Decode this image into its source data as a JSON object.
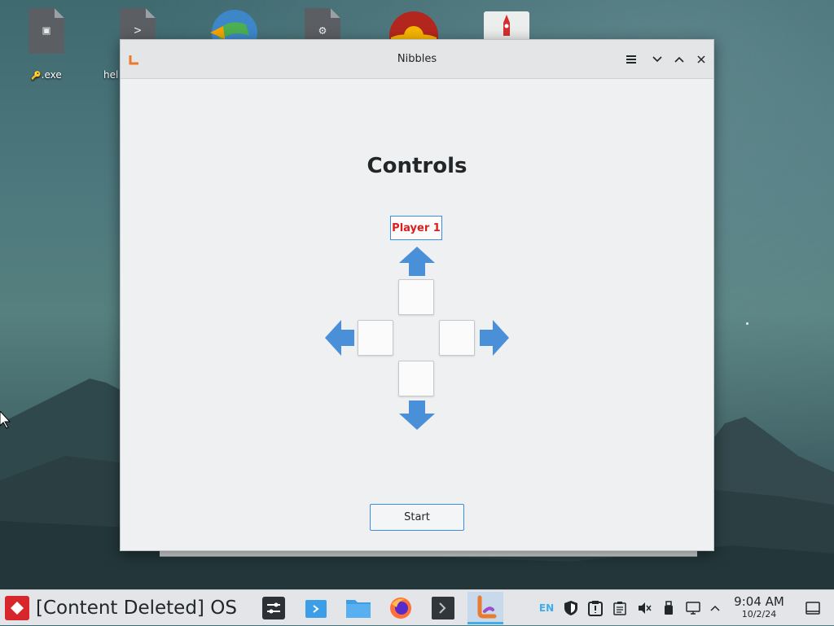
{
  "desktop": {
    "icons": [
      {
        "label": ".exe",
        "prefix_glyph": "🔑",
        "kind": "exe-file-icon"
      },
      {
        "label": "hel",
        "kind": "script-file-icon"
      },
      {
        "label": "",
        "kind": "globe-download-icon"
      },
      {
        "label": "",
        "kind": "settings-file-icon"
      },
      {
        "label": "",
        "kind": "chrome-app-icon"
      },
      {
        "label": "",
        "kind": "rocket-app-icon"
      }
    ]
  },
  "window": {
    "title": "Nibbles",
    "heading": "Controls",
    "player_label": "Player 1",
    "start_label": "Start",
    "player_color": "#da1d1d",
    "accent_color": "#3b8de0",
    "arrow_color": "#4a90d9"
  },
  "taskbar": {
    "os_name": "[Content Deleted] OS",
    "lang": "EN",
    "time": "9:04 AM",
    "date": "10/2/24",
    "tasks": [
      "mixer-icon",
      "files-app-icon",
      "folder-icon",
      "firefox-icon",
      "terminal-icon",
      "nibbles-app-icon"
    ],
    "tray_icons": [
      "shield-icon",
      "clipboard-alert-icon",
      "clipboard-icon",
      "volume-muted-icon",
      "usb-drive-icon",
      "network-icon",
      "chevron-up-icon",
      "show-desktop-icon"
    ]
  }
}
